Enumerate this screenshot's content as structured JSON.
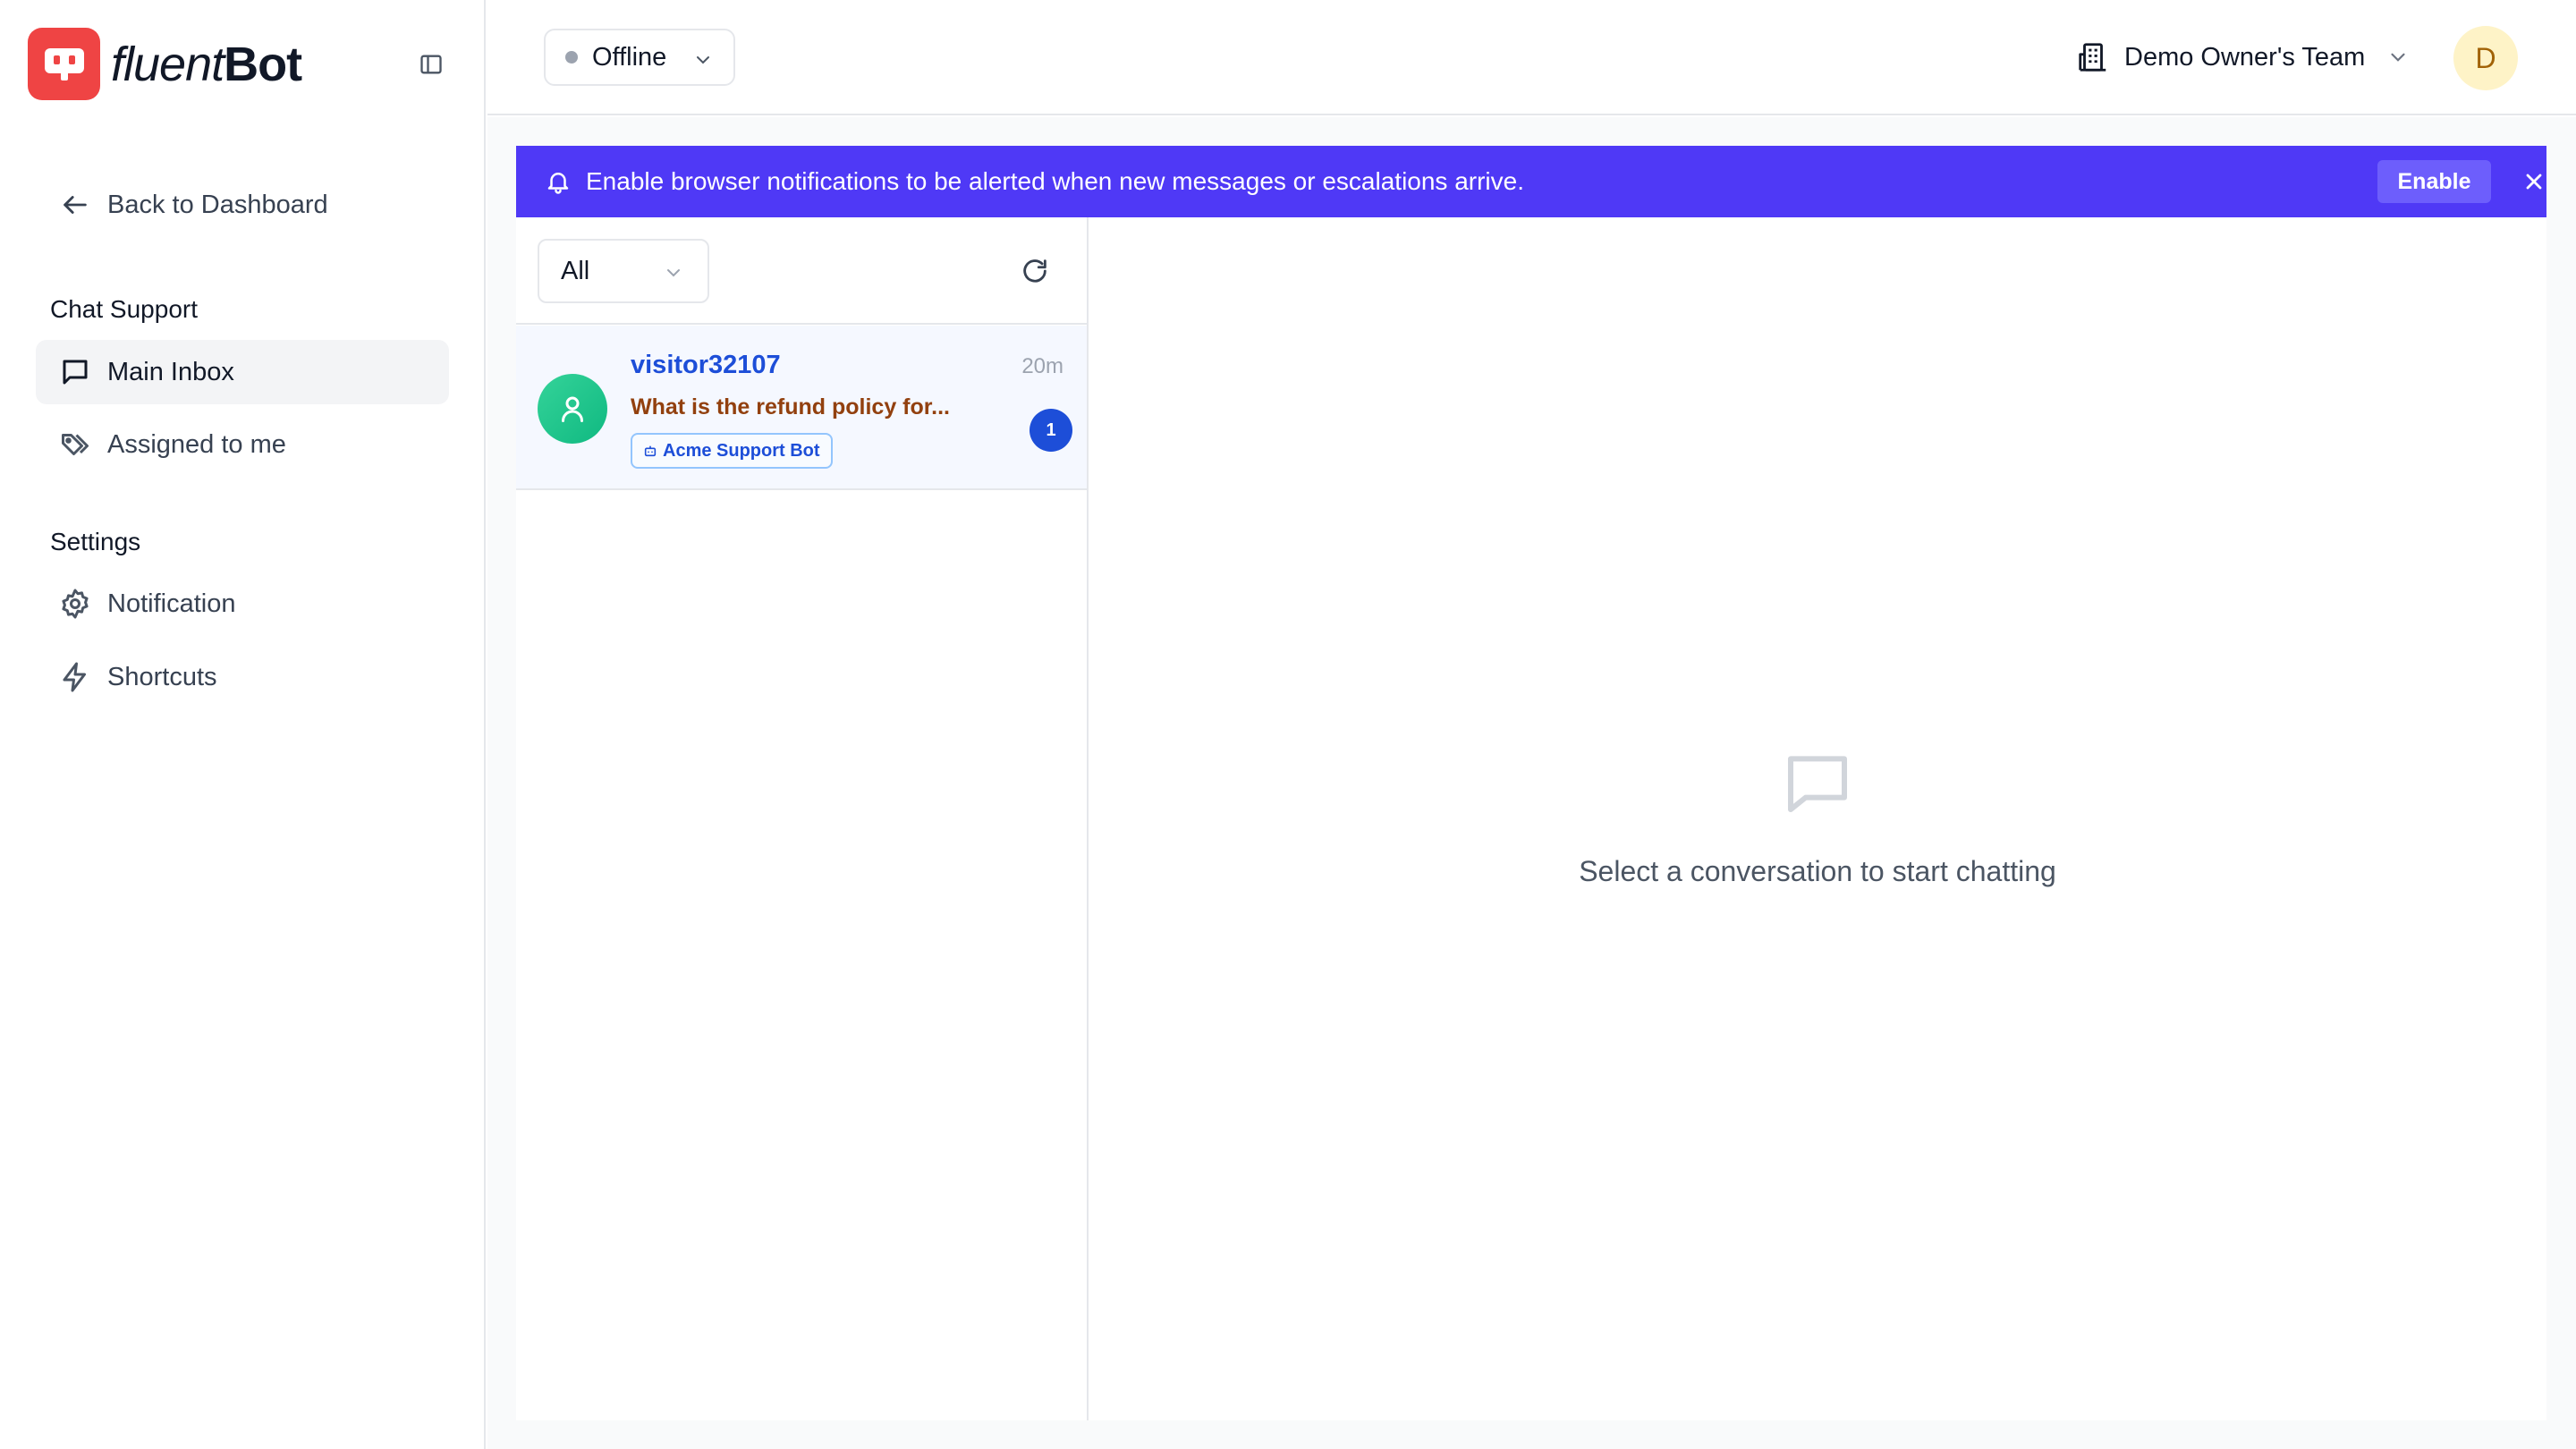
{
  "brand": {
    "name_light": "fluent",
    "name_bold": "Bot",
    "color": "#ef4444"
  },
  "sidebar": {
    "back_label": "Back to Dashboard",
    "sections": [
      {
        "title": "Chat Support"
      },
      {
        "title": "Settings"
      }
    ],
    "items": [
      {
        "label": "Main Inbox",
        "icon": "message-square-icon",
        "active": true
      },
      {
        "label": "Assigned to me",
        "icon": "tags-icon"
      },
      {
        "label": "Notification",
        "icon": "gear-icon"
      },
      {
        "label": "Shortcuts",
        "icon": "lightning-icon"
      }
    ]
  },
  "header": {
    "status": "Offline",
    "team": "Demo Owner's Team",
    "avatar_initial": "D"
  },
  "banner": {
    "message": "Enable browser notifications to be alerted when new messages or escalations arrive.",
    "enable_label": "Enable",
    "color": "#4f39f6"
  },
  "inbox": {
    "filter": "All",
    "conversations": [
      {
        "name": "visitor32107",
        "time": "20m",
        "preview": "What is the refund policy for...",
        "bot": "Acme Support Bot",
        "unread": "1"
      }
    ]
  },
  "chat": {
    "empty_text": "Select a conversation to start chatting"
  }
}
